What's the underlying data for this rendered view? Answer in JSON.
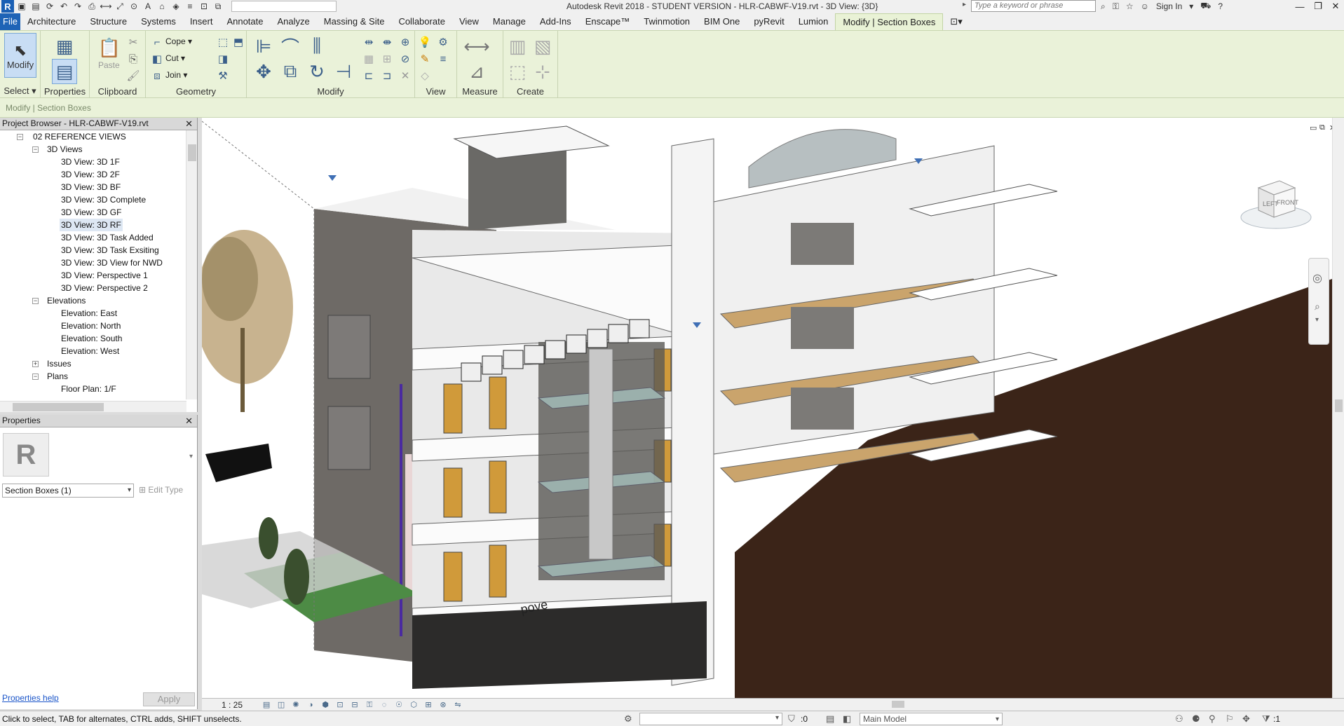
{
  "titlebar": {
    "title": "Autodesk Revit 2018 - STUDENT VERSION -     HLR-CABWF-V19.rvt - 3D View: {3D}",
    "search_placeholder": "Type a keyword or phrase",
    "sign_in": "Sign In",
    "logo": "R"
  },
  "tabs": [
    "File",
    "Architecture",
    "Structure",
    "Systems",
    "Insert",
    "Annotate",
    "Analyze",
    "Massing & Site",
    "Collaborate",
    "View",
    "Manage",
    "Add-Ins",
    "Enscape™",
    "Twinmotion",
    "BIM One",
    "pyRevit",
    "Lumion",
    "Modify | Section Boxes"
  ],
  "ribbon": {
    "select_label": "Select",
    "modify_label": "Modify",
    "properties_label": "Properties",
    "paste_label": "Paste",
    "clipboard_label": "Clipboard",
    "cope_label": "Cope",
    "cut_label": "Cut",
    "join_label": "Join",
    "geometry_label": "Geometry",
    "modify_panel_label": "Modify",
    "view_label": "View",
    "measure_label": "Measure",
    "create_label": "Create"
  },
  "context_bar": "Modify | Section Boxes",
  "project_browser": {
    "title": "Project Browser - HLR-CABWF-V19.rvt",
    "rows": [
      {
        "label": "02 REFERENCE VIEWS",
        "level": 1,
        "toggle": "−"
      },
      {
        "label": "3D Views",
        "level": 2,
        "toggle": "−"
      },
      {
        "label": "3D View: 3D 1F",
        "level": 3
      },
      {
        "label": "3D View: 3D 2F",
        "level": 3
      },
      {
        "label": "3D View: 3D BF",
        "level": 3
      },
      {
        "label": "3D View: 3D Complete",
        "level": 3
      },
      {
        "label": "3D View: 3D GF",
        "level": 3
      },
      {
        "label": "3D View: 3D RF",
        "level": 3,
        "selected": true
      },
      {
        "label": "3D View: 3D Task Added",
        "level": 3
      },
      {
        "label": "3D View: 3D Task Exsiting",
        "level": 3
      },
      {
        "label": "3D View: 3D View for NWD",
        "level": 3
      },
      {
        "label": "3D View: Perspective 1",
        "level": 3
      },
      {
        "label": "3D View: Perspective 2",
        "level": 3
      },
      {
        "label": "Elevations",
        "level": 2,
        "toggle": "−"
      },
      {
        "label": "Elevation: East",
        "level": 3
      },
      {
        "label": "Elevation: North",
        "level": 3
      },
      {
        "label": "Elevation: South",
        "level": 3
      },
      {
        "label": "Elevation: West",
        "level": 3
      },
      {
        "label": "Issues",
        "level": 2,
        "toggle": "+"
      },
      {
        "label": "Plans",
        "level": 2,
        "toggle": "−"
      },
      {
        "label": "Floor Plan: 1/F",
        "level": 3
      }
    ]
  },
  "properties": {
    "title": "Properties",
    "type_name": "Section Boxes (1)",
    "edit_type": "Edit Type",
    "help": "Properties help",
    "apply": "Apply"
  },
  "view": {
    "scale": "1 : 25",
    "viewcube_left": "LEFT",
    "viewcube_front": "FRONT",
    "storefront_sign": "pove"
  },
  "statusbar": {
    "text": "Click to select, TAB for alternates, CTRL adds, SHIFT unselects.",
    "selection_count": ":0",
    "model": "Main Model",
    "filter_count": ":1"
  },
  "colors": {
    "ribbon_bg": "#eaf2d9",
    "file_tab": "#1e63b6",
    "accent": "#1a5fb4"
  }
}
